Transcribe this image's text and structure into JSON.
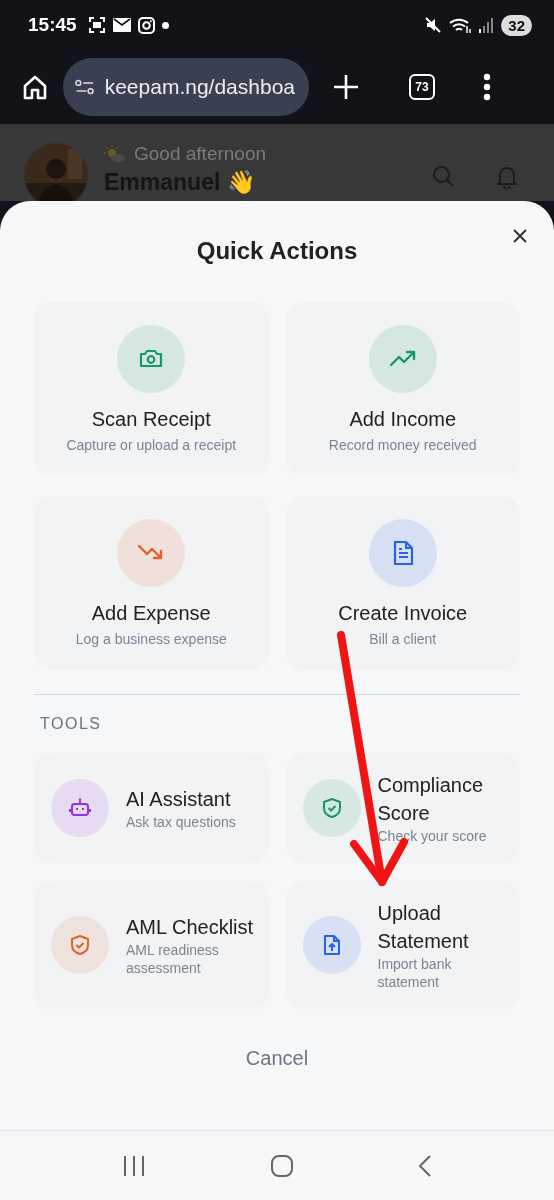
{
  "status_bar": {
    "time": "15:45",
    "battery": "32"
  },
  "browser": {
    "url": "keepam.ng/dashboa",
    "tab_count": "73"
  },
  "dashboard_header": {
    "greeting": "Good afternoon",
    "name": "Emmanuel 👋"
  },
  "sheet": {
    "title": "Quick Actions",
    "actions": [
      {
        "title": "Scan Receipt",
        "subtitle": "Capture or upload a receipt",
        "color": "#16976a"
      },
      {
        "title": "Add Income",
        "subtitle": "Record money received",
        "color": "#16976a"
      },
      {
        "title": "Add Expense",
        "subtitle": "Log a business expense",
        "color": "#e2622a"
      },
      {
        "title": "Create Invoice",
        "subtitle": "Bill a client",
        "color": "#2563eb"
      }
    ],
    "section_label": "TOOLS",
    "tools": [
      {
        "title": "AI Assistant",
        "subtitle": "Ask tax questions",
        "color": "#9333ea"
      },
      {
        "title": "Compliance Score",
        "subtitle": "Check your score",
        "color": "#16976a"
      },
      {
        "title": "AML Checklist",
        "subtitle": "AML readiness assessment",
        "color": "#e2622a"
      },
      {
        "title": "Upload Statement",
        "subtitle": "Import bank statement",
        "color": "#2563eb"
      }
    ],
    "cancel": "Cancel"
  }
}
